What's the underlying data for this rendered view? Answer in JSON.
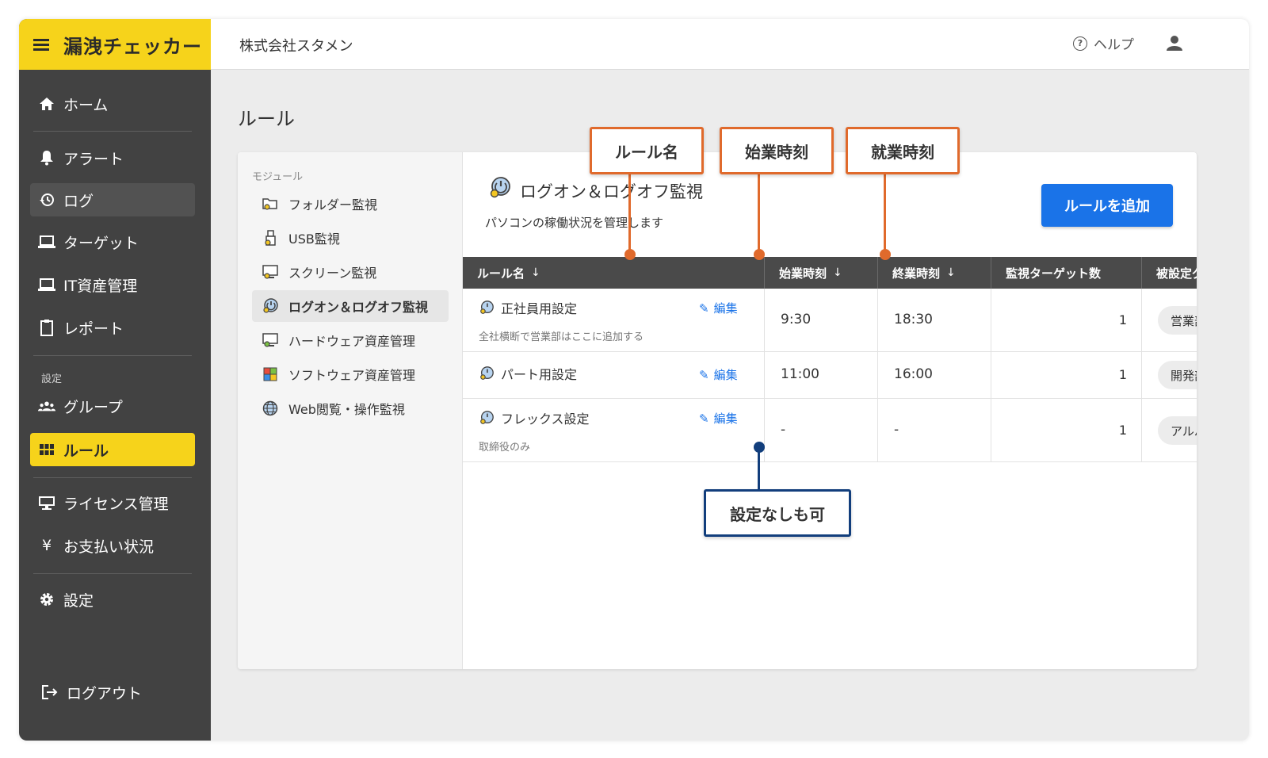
{
  "app": {
    "title": "漏洩チェッカー",
    "company": "株式会社スタメン",
    "help_label": "ヘルプ"
  },
  "sidebar": {
    "items": [
      {
        "label": "ホーム",
        "icon": "home-icon"
      },
      {
        "label": "アラート",
        "icon": "bell-icon"
      },
      {
        "label": "ログ",
        "icon": "history-icon"
      },
      {
        "label": "ターゲット",
        "icon": "laptop-target-icon"
      },
      {
        "label": "IT資産管理",
        "icon": "laptop-icon"
      },
      {
        "label": "レポート",
        "icon": "clipboard-icon"
      },
      {
        "label": "グループ",
        "icon": "group-icon"
      },
      {
        "label": "ルール",
        "icon": "grid-icon"
      },
      {
        "label": "ライセンス管理",
        "icon": "license-icon"
      },
      {
        "label": "お支払い状況",
        "icon": "yen-icon"
      },
      {
        "label": "設定",
        "icon": "gear-icon"
      }
    ],
    "section_settings": "設定",
    "logout_label": "ログアウト"
  },
  "page": {
    "title": "ルール"
  },
  "modules": {
    "heading": "モジュール",
    "items": [
      {
        "label": "フォルダー監視"
      },
      {
        "label": "USB監視"
      },
      {
        "label": "スクリーン監視"
      },
      {
        "label": "ログオン＆ログオフ監視"
      },
      {
        "label": "ハードウェア資産管理"
      },
      {
        "label": "ソフトウェア資産管理"
      },
      {
        "label": "Web閲覧・操作監視"
      }
    ]
  },
  "rule_panel": {
    "title": "ログオン＆ログオフ監視",
    "description": "パソコンの稼働状況を管理します",
    "add_button": "ルールを追加",
    "columns": [
      "ルール名",
      "始業時刻",
      "終業時刻",
      "監視ターゲット数",
      "被設定グル"
    ],
    "sort_arrow": "↓",
    "edit_label": "編集",
    "rows": [
      {
        "name": "正社員用設定",
        "note": "全社横断で営業部はここに追加する",
        "start": "9:30",
        "end": "18:30",
        "targets": "1",
        "group": "営業部"
      },
      {
        "name": "パート用設定",
        "note": "",
        "start": "11:00",
        "end": "16:00",
        "targets": "1",
        "group": "開発部"
      },
      {
        "name": "フレックス設定",
        "note": "取締役のみ",
        "start": "-",
        "end": "-",
        "targets": "1",
        "group": "アルバイ"
      }
    ]
  },
  "callouts": {
    "rule_name": "ルール名",
    "start_time": "始業時刻",
    "end_time": "就業時刻",
    "optional": "設定なしも可"
  },
  "colors": {
    "brand": "#f6d31b",
    "sidebar": "#424242",
    "primary": "#1a73e8",
    "callout_orange": "#e06a2c",
    "callout_blue": "#123e7c"
  }
}
